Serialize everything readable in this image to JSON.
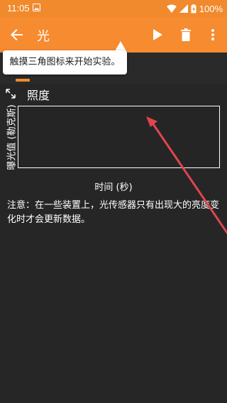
{
  "status_bar": {
    "time": "11:05",
    "battery": "100%"
  },
  "app_bar": {
    "title": "光",
    "back_icon": "arrow-back-icon",
    "actions": [
      "play-icon",
      "delete-icon",
      "more-vert-icon"
    ],
    "color": "#f68b2f"
  },
  "tooltip": {
    "text": "触摸三角图标来开始实验。"
  },
  "graph": {
    "title": "照度",
    "y_label": "曝光值 (勒克斯)",
    "x_label": "时间 (秒)"
  },
  "note": "注意：在一些装置上，光传感器只有出现大的亮度变化时才会更新数据。",
  "colors": {
    "accent": "#f08a2c",
    "background": "#262626",
    "annotation_arrow": "#e0454f"
  }
}
